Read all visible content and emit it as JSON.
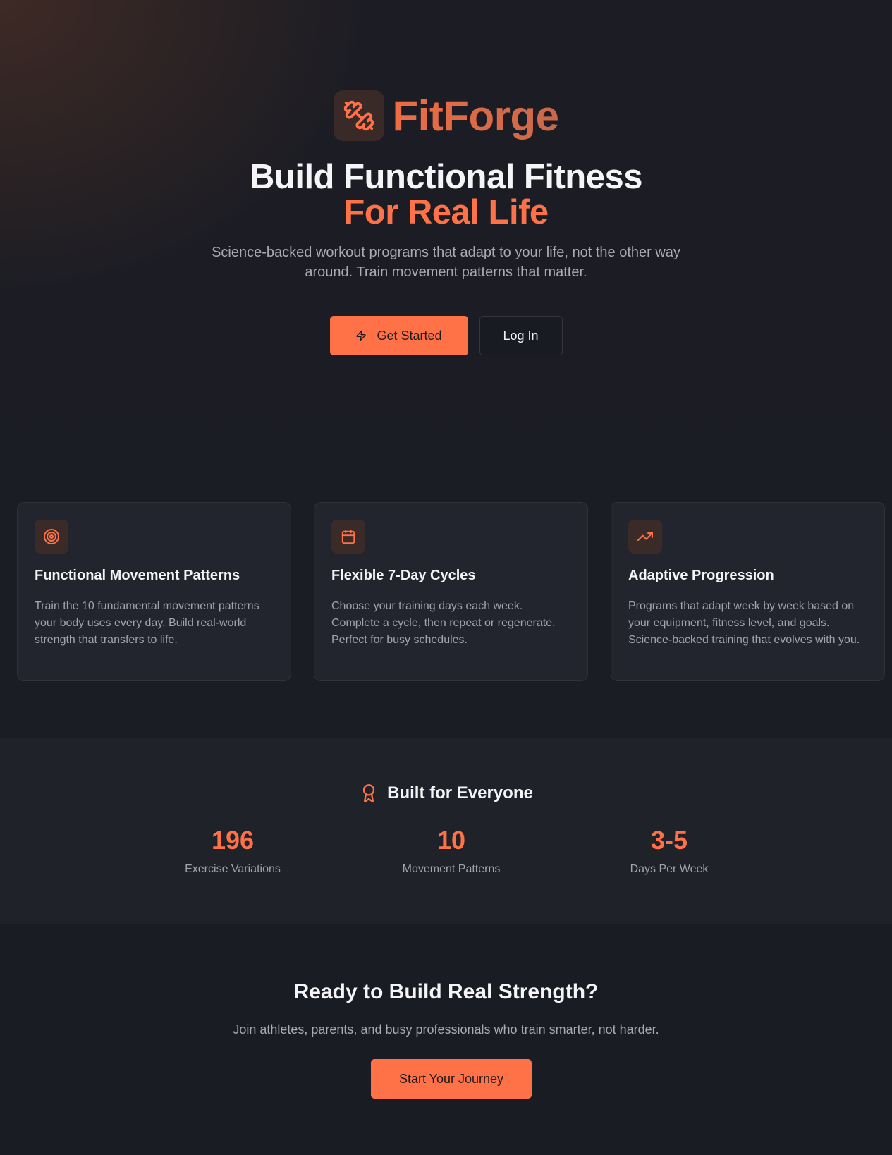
{
  "brand": {
    "name": "FitForge",
    "logo_icon": "dumbbell-icon",
    "accent": "#ff7147"
  },
  "hero": {
    "headline_line1": "Build Functional Fitness",
    "headline_line2": "For Real Life",
    "subtitle": "Science-backed workout programs that adapt to your life, not the other way around. Train movement patterns that matter.",
    "primary_cta": {
      "label": "Get Started",
      "icon": "zap-icon"
    },
    "secondary_cta": {
      "label": "Log In"
    }
  },
  "features": [
    {
      "icon": "target-icon",
      "title": "Functional Movement Patterns",
      "description": "Train the 10 fundamental movement patterns your body uses every day. Build real-world strength that transfers to life."
    },
    {
      "icon": "calendar-icon",
      "title": "Flexible 7-Day Cycles",
      "description": "Choose your training days each week. Complete a cycle, then repeat or regenerate. Perfect for busy schedules."
    },
    {
      "icon": "trending-up-icon",
      "title": "Adaptive Progression",
      "description": "Programs that adapt week by week based on your equipment, fitness level, and goals. Science-backed training that evolves with you."
    }
  ],
  "stats": {
    "heading": "Built for Everyone",
    "heading_icon": "award-icon",
    "items": [
      {
        "value": "196",
        "label": "Exercise Variations"
      },
      {
        "value": "10",
        "label": "Movement Patterns"
      },
      {
        "value": "3-5",
        "label": "Days Per Week"
      }
    ]
  },
  "final_cta": {
    "title": "Ready to Build Real Strength?",
    "subtitle": "Join athletes, parents, and busy professionals who train smarter, not harder.",
    "button_label": "Start Your Journey"
  }
}
